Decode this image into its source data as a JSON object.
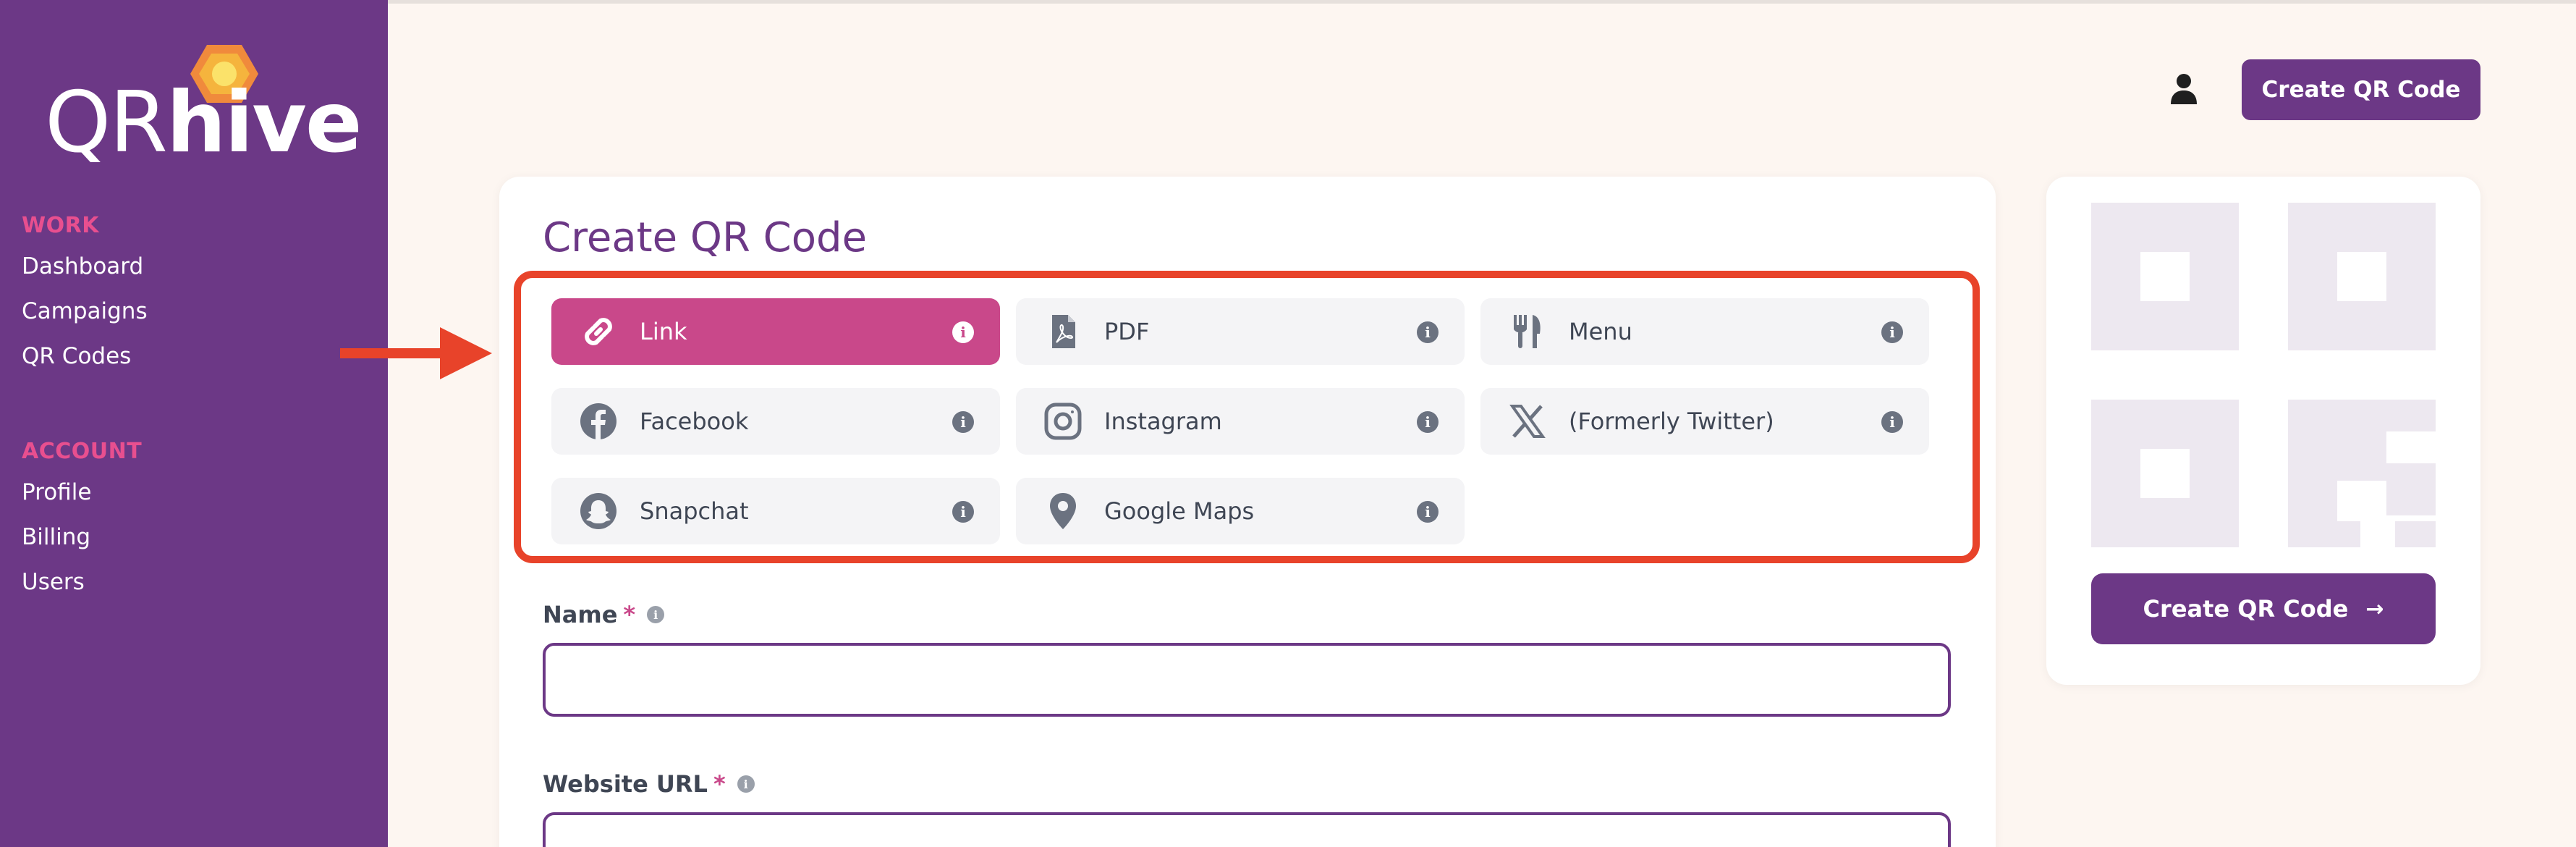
{
  "logo": {
    "prefix": "QR",
    "suffix": "hive"
  },
  "sidebar": {
    "work_heading": "WORK",
    "work_items": [
      "Dashboard",
      "Campaigns",
      "QR Codes"
    ],
    "account_heading": "ACCOUNT",
    "account_items": [
      "Profile",
      "Billing",
      "Users"
    ]
  },
  "header": {
    "create_button": "Create QR Code"
  },
  "page": {
    "title": "Create QR Code"
  },
  "qr_types": [
    {
      "label": "Link",
      "icon": "link-icon",
      "active": true
    },
    {
      "label": "PDF",
      "icon": "pdf-icon",
      "active": false
    },
    {
      "label": "Menu",
      "icon": "utensils-icon",
      "active": false
    },
    {
      "label": "Facebook",
      "icon": "facebook-icon",
      "active": false
    },
    {
      "label": "Instagram",
      "icon": "instagram-icon",
      "active": false
    },
    {
      "label": "(Formerly Twitter)",
      "icon": "x-icon",
      "active": false
    },
    {
      "label": "Snapchat",
      "icon": "snapchat-icon",
      "active": false
    },
    {
      "label": "Google Maps",
      "icon": "map-pin-icon",
      "active": false
    }
  ],
  "form": {
    "name_label": "Name",
    "required_mark": "*",
    "name_value": "",
    "url_label": "Website URL",
    "url_value": ""
  },
  "preview": {
    "button_label": "Create QR Code",
    "button_arrow": "→"
  },
  "info_glyph": "i",
  "colors": {
    "brand_purple": "#6c3886",
    "accent_pink": "#c9488a",
    "annotation_red": "#e8432a",
    "background": "#fdf6f1"
  }
}
